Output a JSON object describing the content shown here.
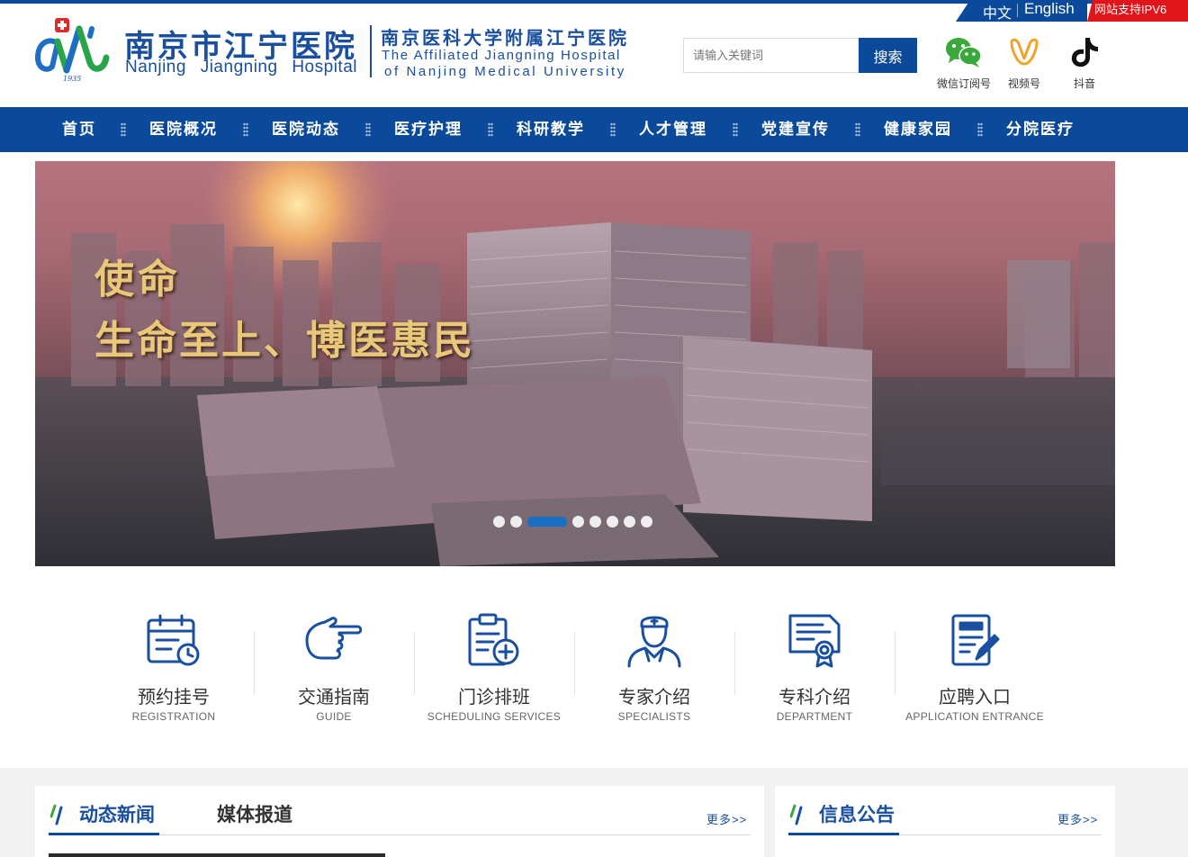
{
  "header": {
    "logo_cn": "南京市江宁医院",
    "logo_en": "Nanjing Jiangning Hospital",
    "logo_year": "1935",
    "affiliation_cn": "南京医科大学附属江宁医院",
    "affiliation_en_line1": "The Affiliated Jiangning Hospital",
    "affiliation_en_line2": "of Nanjing Medical University",
    "lang_zh": "中文",
    "lang_en": "English",
    "ipv6_badge": "网站支持IPV6",
    "search_placeholder": "请输入关键词",
    "search_button": "搜索",
    "social": [
      {
        "label": "微信订阅号",
        "icon": "wechat-icon"
      },
      {
        "label": "视频号",
        "icon": "channels-icon"
      },
      {
        "label": "抖音",
        "icon": "douyin-icon"
      }
    ]
  },
  "nav": {
    "items": [
      "首页",
      "医院概况",
      "医院动态",
      "医疗护理",
      "科研教学",
      "人才管理",
      "党建宣传",
      "健康家园",
      "分院医疗"
    ]
  },
  "banner": {
    "slogan_line1": "使命",
    "slogan_line2": "生命至上、博医惠民",
    "slide_count": 8,
    "active_slide": 3
  },
  "quick_links": [
    {
      "cn": "预约挂号",
      "en": "REGISTRATION",
      "icon": "calendar-clock-icon"
    },
    {
      "cn": "交通指南",
      "en": "GUIDE",
      "icon": "pointing-hand-icon"
    },
    {
      "cn": "门诊排班",
      "en": "SCHEDULING SERVICES",
      "icon": "clipboard-medical-icon"
    },
    {
      "cn": "专家介绍",
      "en": "SPECIALISTS",
      "icon": "doctor-icon"
    },
    {
      "cn": "专科介绍",
      "en": "DEPARTMENT",
      "icon": "certificate-icon"
    },
    {
      "cn": "应聘入口",
      "en": "APPLICATION ENTRANCE",
      "icon": "document-edit-icon"
    }
  ],
  "news": {
    "tab_active": "动态新闻",
    "tab_other": "媒体报道",
    "more": "更多>>"
  },
  "notice": {
    "title": "信息公告",
    "more": "更多>>"
  },
  "colors": {
    "brand_blue": "#0b4a9b",
    "ipv6_red": "#e0151b",
    "slogan_gold": "#e9c979"
  }
}
